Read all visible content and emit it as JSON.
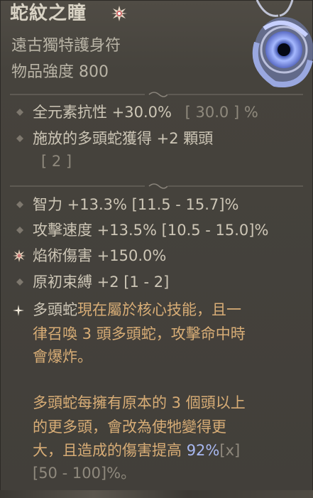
{
  "item": {
    "name": "蛇紋之瞳",
    "type": "遠古獨特護身符",
    "power": "物品強度 800"
  },
  "implicit": [
    {
      "text": "全元素抗性 +30.0%",
      "range": "[ 30.0 ] %"
    },
    {
      "text": "施放的多頭蛇獲得 +2 顆頭",
      "range": "[ 2 ]"
    }
  ],
  "affixes": [
    {
      "text": "智力 +13.3% [11.5 - 15.7]%"
    },
    {
      "text": "攻擊速度 +13.5% [10.5 - 15.0]%"
    },
    {
      "text": "焰術傷害 +150.0%"
    },
    {
      "text": "原初束縛 +2 [1 - 2]"
    }
  ],
  "unique_power": {
    "line1_a": "多頭蛇",
    "line1_b": "現在屬於核心技能，且一",
    "line2": "律召喚 3 頭多頭蛇，攻擊命中時",
    "line3": "會爆炸。",
    "para2_line1": "多頭蛇每擁有原本的 3 個頭以上",
    "para2_line2": "的更多頭，會改為使牠變得更",
    "para2_line3_a": "大，且造成的傷害提高 ",
    "para2_value": "92%",
    "para2_x": "[x]",
    "para2_line4": "[50 - 100]%。"
  },
  "colors": {
    "title": "#d8d2c4",
    "text": "#cdc6b6",
    "orange": "#d8ad76",
    "blue": "#a8b8f0",
    "muted": "#8f897d"
  },
  "icons": {
    "title": "star-burst-icon",
    "bullet": "diamond-bullet-icon",
    "greater_bullet": "star-bullet-icon",
    "unique_bullet": "sparkle-bullet-icon",
    "item": "serpent-eye-amulet-icon"
  }
}
